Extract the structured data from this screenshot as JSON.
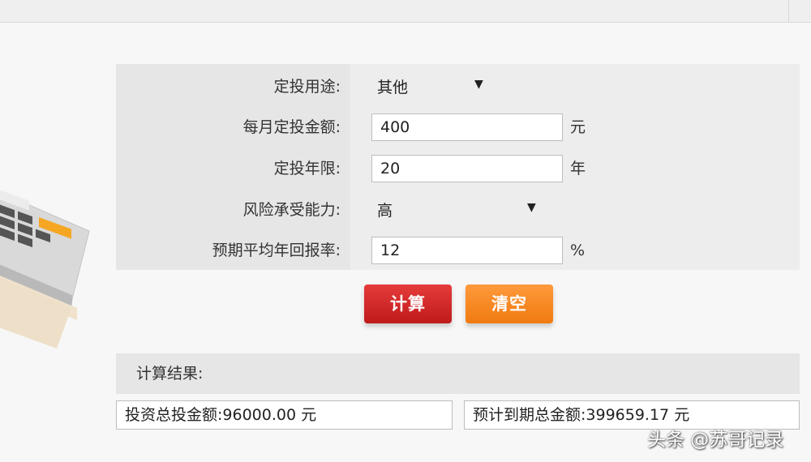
{
  "form": {
    "purpose": {
      "label": "定投用途:",
      "value": "其他"
    },
    "monthly_amount": {
      "label": "每月定投金额:",
      "value": "400",
      "unit": "元"
    },
    "years": {
      "label": "定投年限:",
      "value": "20",
      "unit": "年"
    },
    "risk": {
      "label": "风险承受能力:",
      "value": "高"
    },
    "expected_rate": {
      "label": "预期平均年回报率:",
      "value": "12",
      "unit": "%"
    }
  },
  "buttons": {
    "calculate": "计算",
    "clear": "清空"
  },
  "result": {
    "header": "计算结果:",
    "total_invested": "投资总投金额:96000.00 元",
    "expected_total": "预计到期总金额:399659.17 元"
  },
  "watermark": "头条 @苏哥记录",
  "colors": {
    "calculate_button": "#d32a2a",
    "clear_button": "#f5871f",
    "panel_bg": "#ededed"
  }
}
